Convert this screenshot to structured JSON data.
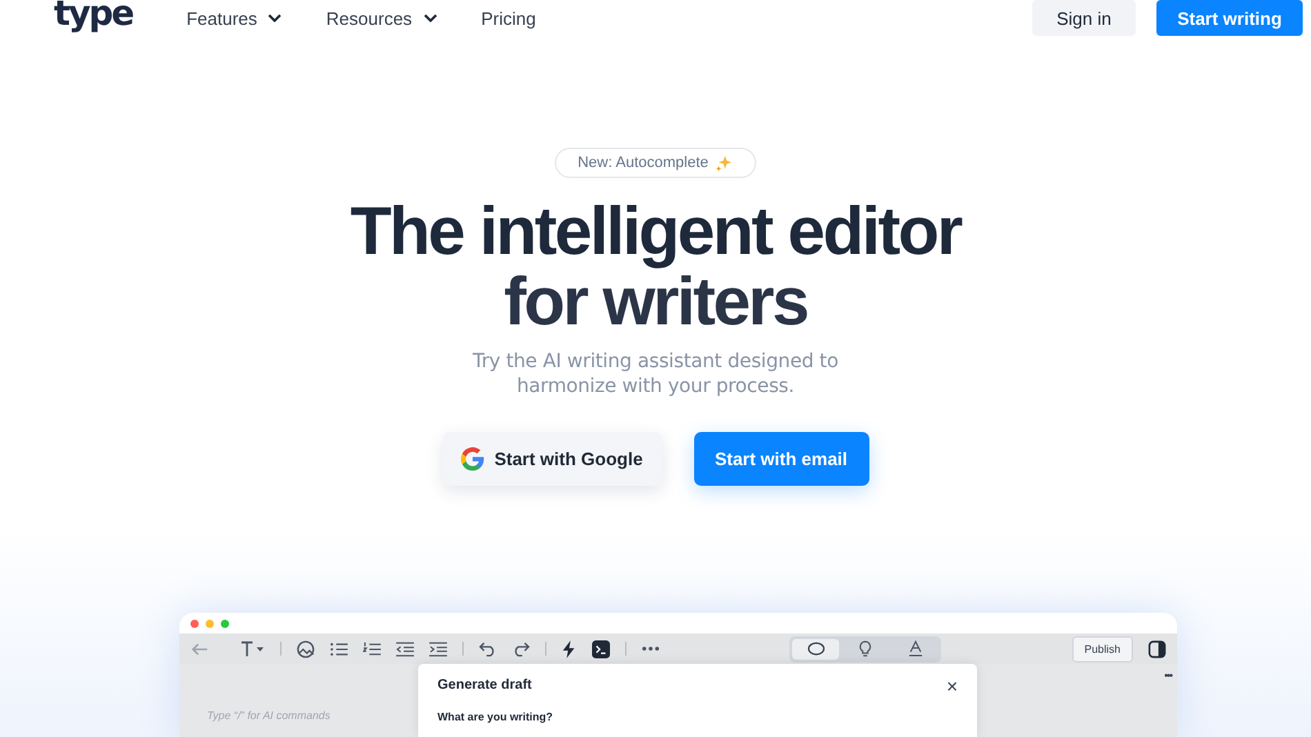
{
  "nav": {
    "logo": "type",
    "links": [
      {
        "label": "Features",
        "dropdown": true
      },
      {
        "label": "Resources",
        "dropdown": true
      },
      {
        "label": "Pricing",
        "dropdown": false
      }
    ],
    "sign_in": "Sign in",
    "cta": "Start writing"
  },
  "hero": {
    "badge": "New: Autocomplete",
    "title_lines": [
      "The intelligent editor",
      "for writers"
    ],
    "subtitle_lines": [
      "Try the AI writing assistant designed to",
      "harmonize with your process."
    ],
    "google_button": "Start with Google",
    "email_button": "Start with email"
  },
  "editor": {
    "modes": [
      {
        "selected": true
      },
      {
        "selected": false
      },
      {
        "selected": false
      }
    ],
    "publish": "Publish",
    "placeholder": "Type “/” for AI commands",
    "more": "•••",
    "dialog": {
      "title": "Generate draft",
      "close": "×",
      "question": "What are you writing?"
    }
  }
}
